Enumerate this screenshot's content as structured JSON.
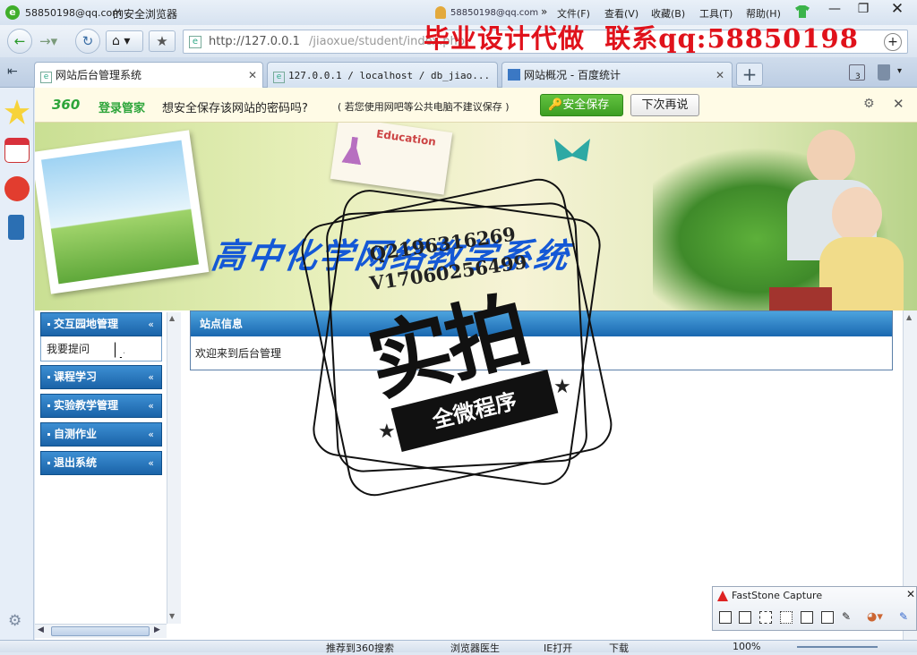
{
  "browser": {
    "user": "58850198@qq.com",
    "title_suffix": "的安全浏览器",
    "user_small": "58850198@qq.com",
    "menu": [
      "文件(F)",
      "查看(V)",
      "收藏(B)",
      "工具(T)",
      "帮助(H)"
    ],
    "address_host": "http://127.0.0.1",
    "address_path": "/jiaoxue/student/index.php",
    "tab_count": "3",
    "tabs": [
      {
        "label": "网站后台管理系统"
      },
      {
        "label": "127.0.0.1 / localhost / db_jiao..."
      },
      {
        "label": "网站概况 - 百度统计"
      }
    ]
  },
  "watermark": {
    "ad_text": "毕业设计代做  联系qq:58850198",
    "stamp_line1": "Q2196316269",
    "stamp_line2": "V17060256499",
    "stamp_main": "实拍",
    "stamp_sub": "全微程序"
  },
  "password_bar": {
    "brand_num": "360",
    "brand": "登录管家",
    "question": "想安全保存该网站的密码吗?",
    "note": "( 若您使用网吧等公共电脑不建议保存 )",
    "save_button": "安全保存",
    "later_button": "下次再说"
  },
  "site": {
    "banner_title": "高中化学网络教学系统",
    "education_card": "Education",
    "nav": [
      {
        "label": "交互园地管理",
        "children": [
          "我要提问"
        ]
      },
      {
        "label": "课程学习"
      },
      {
        "label": "实验教学管理"
      },
      {
        "label": "自测作业"
      },
      {
        "label": "退出系统"
      }
    ],
    "panel_title": "站点信息",
    "panel_body": "欢迎来到后台管理"
  },
  "statusbar": {
    "items": [
      "推荐到360搜索",
      "浏览器医生",
      "IE打开",
      "下载"
    ],
    "zoom": "100%"
  },
  "faststone": {
    "title": "FastStone Capture"
  },
  "colors": {
    "nav_blue": "#1a63a8",
    "save_green": "#4caf2e",
    "ad_red": "#e0121b",
    "banner_title_blue": "#1458d6"
  }
}
